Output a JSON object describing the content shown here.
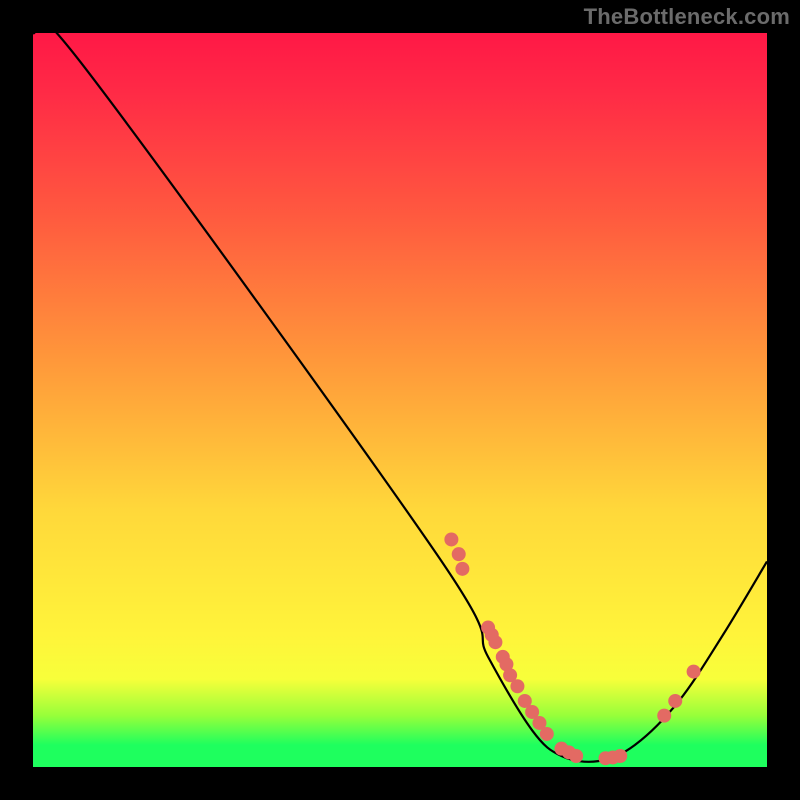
{
  "attribution": "TheBottleneck.com",
  "chart_data": {
    "type": "line",
    "title": "",
    "xlabel": "",
    "ylabel": "",
    "x_range": [
      0,
      100
    ],
    "y_range": [
      0,
      100
    ],
    "curve": [
      {
        "x": 0,
        "y": 100
      },
      {
        "x": 6.5,
        "y": 96
      },
      {
        "x": 55,
        "y": 29
      },
      {
        "x": 62,
        "y": 15
      },
      {
        "x": 68,
        "y": 5
      },
      {
        "x": 72,
        "y": 1.5
      },
      {
        "x": 77,
        "y": 0.8
      },
      {
        "x": 82,
        "y": 3
      },
      {
        "x": 88,
        "y": 9
      },
      {
        "x": 94,
        "y": 18
      },
      {
        "x": 100,
        "y": 28
      }
    ],
    "points": [
      {
        "x": 57,
        "y": 31
      },
      {
        "x": 58,
        "y": 29
      },
      {
        "x": 58.5,
        "y": 27
      },
      {
        "x": 62,
        "y": 19
      },
      {
        "x": 62.5,
        "y": 18
      },
      {
        "x": 63,
        "y": 17
      },
      {
        "x": 64,
        "y": 15
      },
      {
        "x": 64.5,
        "y": 14
      },
      {
        "x": 65,
        "y": 12.5
      },
      {
        "x": 66,
        "y": 11
      },
      {
        "x": 67,
        "y": 9
      },
      {
        "x": 68,
        "y": 7.5
      },
      {
        "x": 69,
        "y": 6
      },
      {
        "x": 70,
        "y": 4.5
      },
      {
        "x": 72,
        "y": 2.5
      },
      {
        "x": 73,
        "y": 2
      },
      {
        "x": 74,
        "y": 1.5
      },
      {
        "x": 78,
        "y": 1.2
      },
      {
        "x": 79,
        "y": 1.3
      },
      {
        "x": 80,
        "y": 1.5
      },
      {
        "x": 86,
        "y": 7
      },
      {
        "x": 87.5,
        "y": 9
      },
      {
        "x": 90,
        "y": 13
      }
    ],
    "point_radius": 7,
    "colors": {
      "curve": "#000000",
      "points": "#e36a63"
    }
  }
}
